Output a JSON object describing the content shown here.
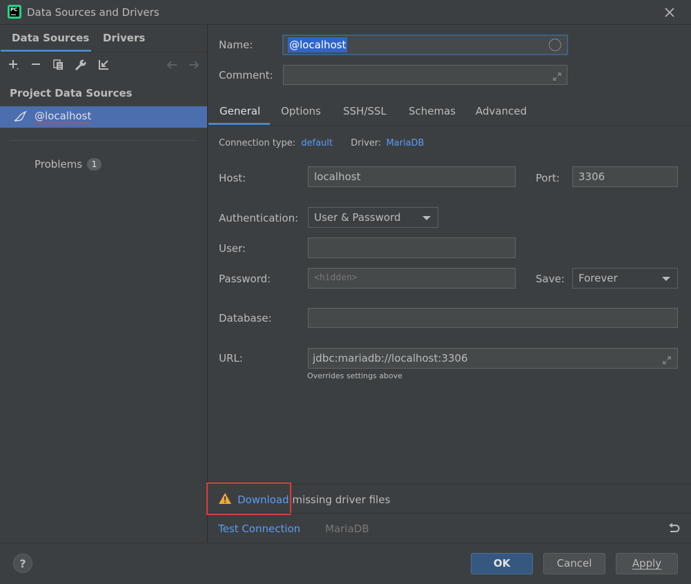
{
  "window": {
    "title": "Data Sources and Drivers",
    "app_icon": "pycharm-icon",
    "app_icon_text": "PC"
  },
  "left": {
    "tabs": [
      "Data Sources",
      "Drivers"
    ],
    "section_title": "Project Data Sources",
    "data_source": "@localhost",
    "problems_label": "Problems",
    "problems_count": "1",
    "toolbar_icons": [
      "add-icon",
      "remove-icon",
      "duplicate-icon",
      "wrench-icon",
      "import-icon",
      "back-arrow-icon",
      "forward-arrow-icon"
    ]
  },
  "form": {
    "name_label": "Name:",
    "name_value": "@localhost",
    "comment_label": "Comment:",
    "comment_value": "",
    "tabs": [
      "General",
      "Options",
      "SSH/SSL",
      "Schemas",
      "Advanced"
    ],
    "connection_type_label": "Connection type:",
    "connection_type_value": "default",
    "driver_label": "Driver:",
    "driver_value": "MariaDB",
    "host_label": "Host:",
    "host_value": "localhost",
    "port_label": "Port:",
    "port_value": "3306",
    "auth_label": "Authentication:",
    "auth_value": "User & Password",
    "user_label": "User:",
    "user_value": "",
    "password_label": "Password:",
    "password_placeholder": "<hidden>",
    "save_label": "Save:",
    "save_value": "Forever",
    "database_label": "Database:",
    "database_value": "",
    "url_label": "URL:",
    "url_value": "jdbc:mariadb://localhost:3306",
    "url_note": "Overrides settings above"
  },
  "footer": {
    "download_link": "Download",
    "download_rest": " missing driver files",
    "test_connection": "Test Connection",
    "driver_name": "MariaDB"
  },
  "buttons": {
    "help": "?",
    "ok": "OK",
    "cancel": "Cancel",
    "apply": "Apply"
  },
  "colors": {
    "accent": "#4a88c7",
    "link": "#589df6",
    "selection": "#4b6eaf",
    "highlight_box": "#e03b3b",
    "warning": "#f0a732"
  }
}
